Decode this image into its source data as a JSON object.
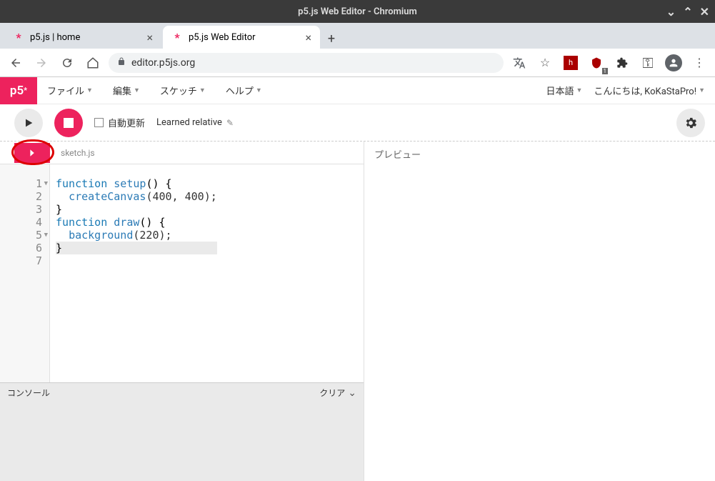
{
  "window": {
    "title": "p5.js Web Editor - Chromium"
  },
  "tabs": [
    {
      "title": "p5.js | home"
    },
    {
      "title": "p5.js Web Editor"
    }
  ],
  "address": {
    "url": "editor.p5js.org"
  },
  "p5menu": {
    "file": "ファイル",
    "edit": "編集",
    "sketch": "スケッチ",
    "help": "ヘルプ"
  },
  "p5right": {
    "language": "日本語",
    "greeting": "こんにちは, KoKaStaPro!"
  },
  "toolbar": {
    "auto_update": "自動更新",
    "sketch_name": "Learned relative"
  },
  "filetab": {
    "filename": "sketch.js"
  },
  "code": {
    "lines": [
      {
        "n": "1",
        "fold": true
      },
      {
        "n": "2"
      },
      {
        "n": "3"
      },
      {
        "n": "4"
      },
      {
        "n": "5",
        "fold": true
      },
      {
        "n": "6"
      },
      {
        "n": "7"
      }
    ],
    "l1_kw": "function",
    "l1_fn": "setup",
    "l1_rest_a": "() {",
    "l2_fn": "createCanvas",
    "l2_args": "(400, 400);",
    "l3": "}",
    "l4": "",
    "l5_kw": "function",
    "l5_fn": "draw",
    "l5_rest_a": "() {",
    "l6_fn": "background",
    "l6_args": "(220);",
    "l7": "}"
  },
  "console": {
    "label": "コンソール",
    "clear": "クリア"
  },
  "preview": {
    "label": "プレビュー"
  }
}
